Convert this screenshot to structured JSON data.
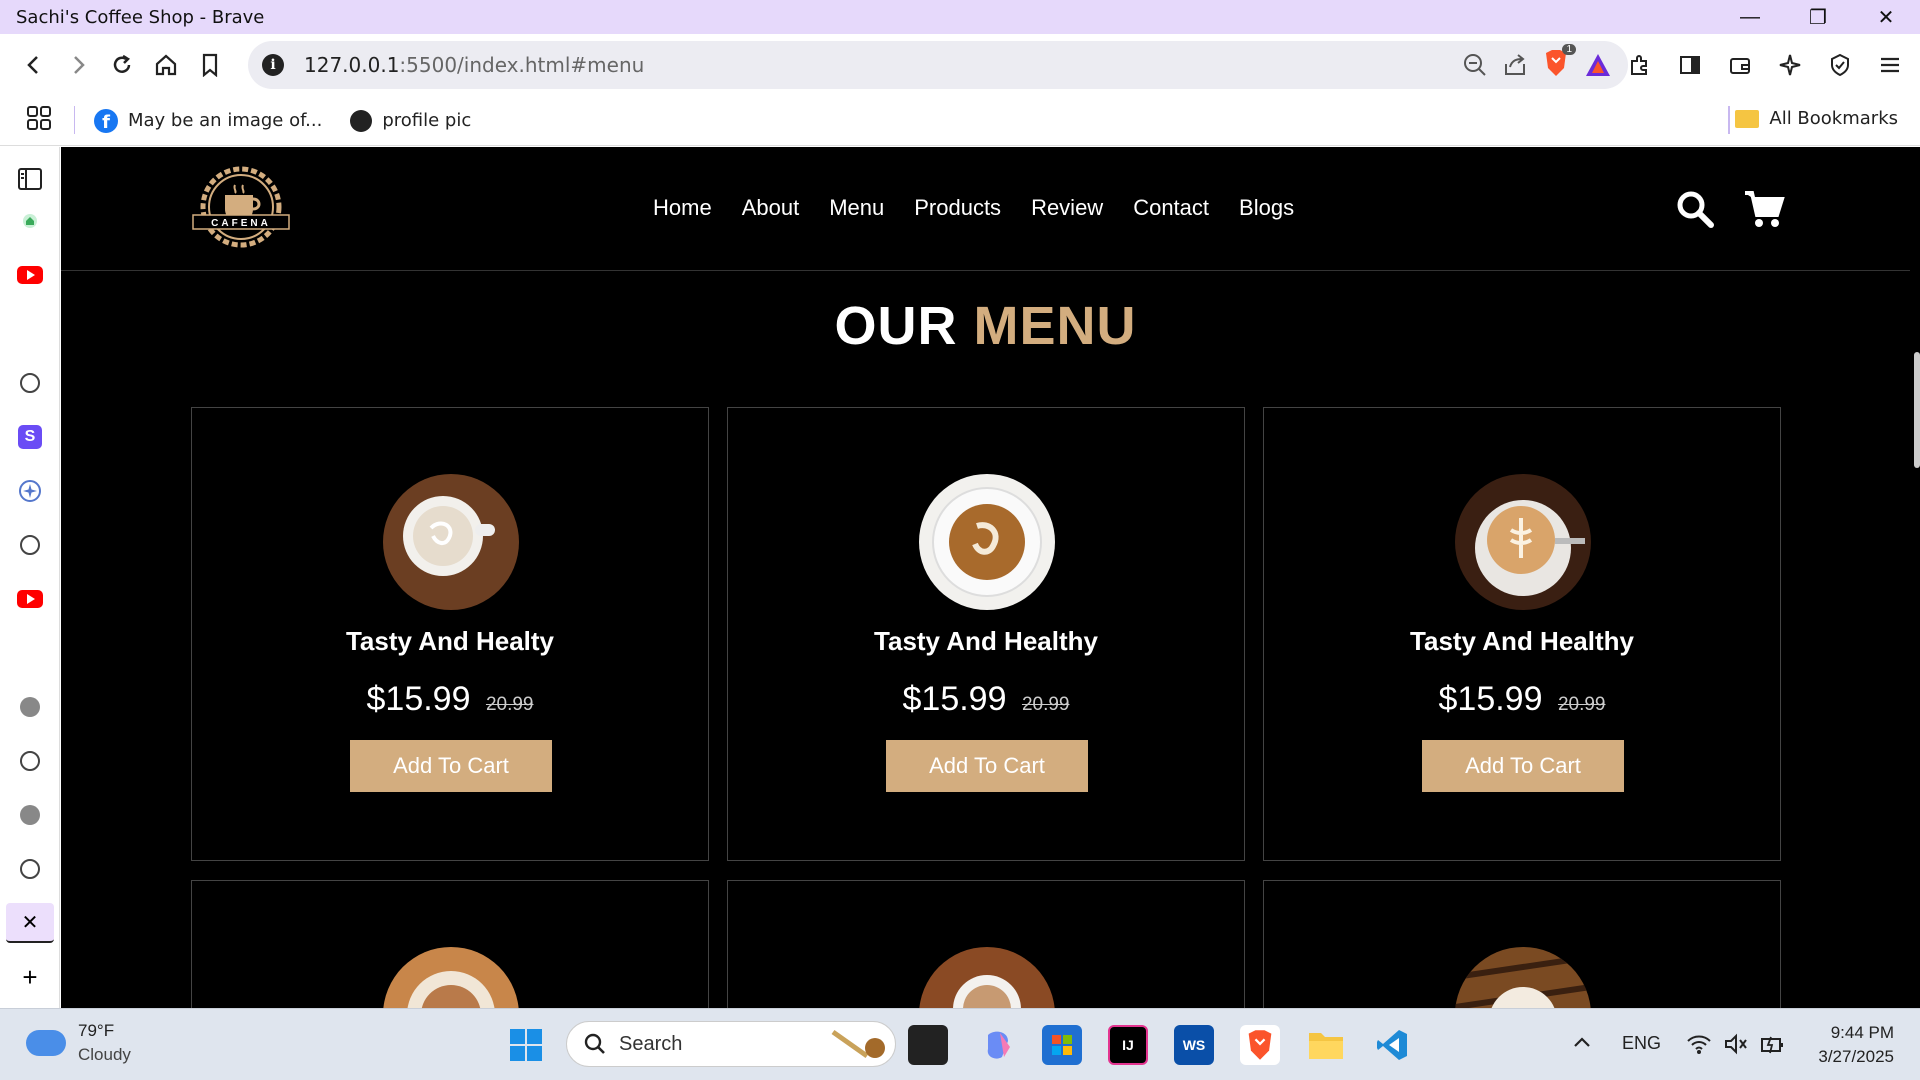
{
  "window": {
    "title": "Sachi's Coffee Shop - Brave",
    "minimize": "—",
    "restore": "❐",
    "close": "✕"
  },
  "nav": {
    "back": "‹",
    "forward": "›",
    "reload": "↻",
    "home": "⌂",
    "url_host": "127.0.0.1",
    "url_rest": ":5500/index.html#menu",
    "shield_badge": "1"
  },
  "bookmarks": {
    "items": [
      {
        "label": "May be an image of...",
        "icon": "facebook-icon"
      },
      {
        "label": "profile pic",
        "icon": "globe-icon"
      }
    ],
    "all_bookmarks": "All Bookmarks"
  },
  "sidebar": {
    "add": "+",
    "close": "✕"
  },
  "site": {
    "brand": "CAFENA",
    "menu": [
      "Home",
      "About",
      "Menu",
      "Products",
      "Review",
      "Contact",
      "Blogs"
    ],
    "section_title_main": "OUR",
    "section_title_accent": "MENU",
    "accent_color": "#d3ad7f",
    "cards": [
      {
        "name": "Tasty And Healty",
        "price": "$15.99",
        "old_price": "20.99",
        "button": "Add To Cart"
      },
      {
        "name": "Tasty And Healthy",
        "price": "$15.99",
        "old_price": "20.99",
        "button": "Add To Cart"
      },
      {
        "name": "Tasty And Healthy",
        "price": "$15.99",
        "old_price": "20.99",
        "button": "Add To Cart"
      }
    ]
  },
  "taskbar": {
    "temperature": "79°F",
    "condition": "Cloudy",
    "search_placeholder": "Search",
    "language": "ENG",
    "time": "9:44 PM",
    "date": "3/27/2025"
  }
}
